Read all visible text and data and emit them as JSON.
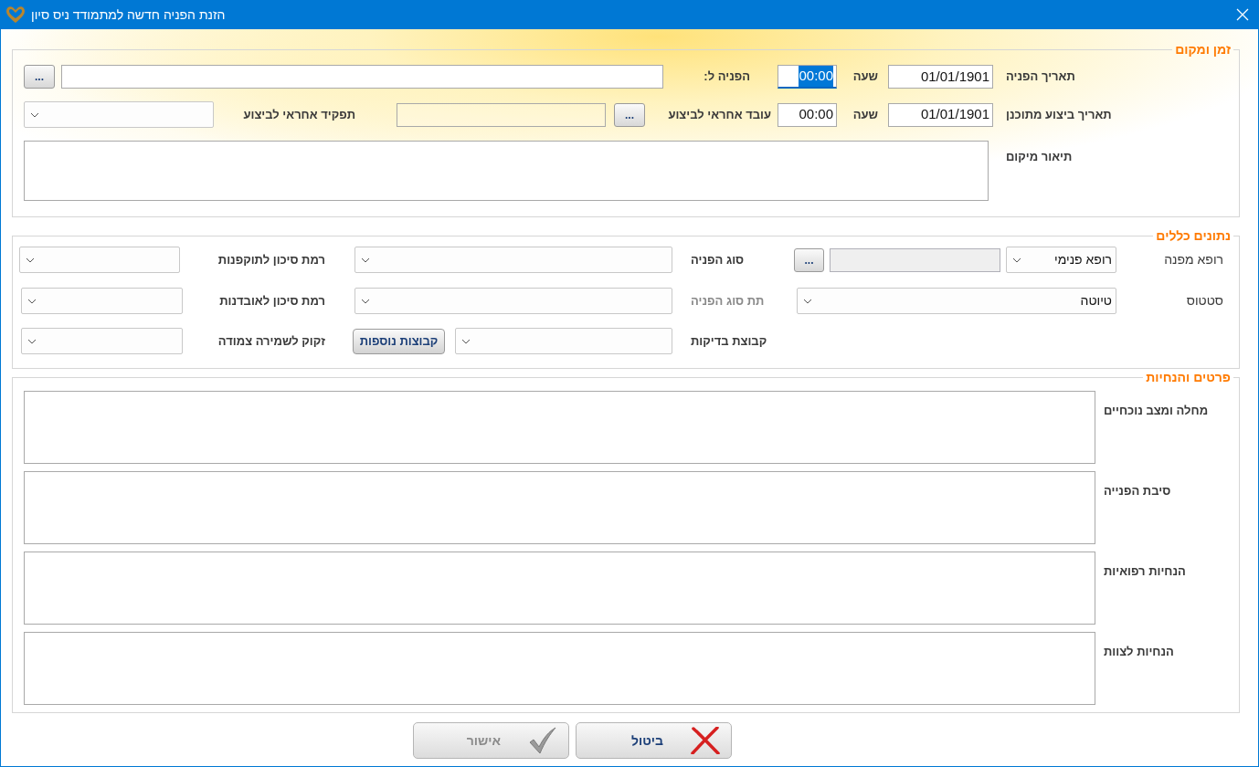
{
  "window": {
    "title": "הזנת הפניה חדשה למתמודד ניס סיון"
  },
  "time_place": {
    "title": "זמן ומקום",
    "referral_date": {
      "label": "תאריך הפניה",
      "value": "01/01/1901"
    },
    "referral_time": {
      "label": "שעה",
      "value": "00:00",
      "focused": true
    },
    "referred_to": {
      "label": "הפניה ל:",
      "button": "..."
    },
    "planned_date": {
      "label": "תאריך ביצוע מתוכנן",
      "value": "01/01/1901"
    },
    "planned_time": {
      "label": "שעה",
      "value": "00:00",
      "focused": false
    },
    "responsible_worker": {
      "label": "עובד אחראי לביצוע",
      "button": "..."
    },
    "responsible_role": {
      "label": "תפקיד אחראי לביצוע"
    },
    "location": {
      "label": "תיאור מיקום"
    }
  },
  "general": {
    "title": "נתונים כללים",
    "referring_doctor": {
      "label": "רופא מפנה",
      "value": "רופא פנימי",
      "button": "...",
      "name_box_disabled": true
    },
    "referral_type": {
      "label": "סוג הפניה"
    },
    "aggression_risk": {
      "label": "רמת סיכון לתוקפנות"
    },
    "status": {
      "label": "סטטוס",
      "value": "טיוטה"
    },
    "referral_subtype": {
      "label": "תת סוג הפניה",
      "disabled": true
    },
    "suicide_risk": {
      "label": "רמת סיכון לאובדנות"
    },
    "test_group": {
      "label": "קבוצת בדיקות"
    },
    "more_groups": {
      "label": "קבוצות נוספות"
    },
    "close_guard": {
      "label": "זקוק לשמירה צמודה"
    }
  },
  "details": {
    "title": "פרטים והנחיות",
    "fields": [
      {
        "label": "מחלה ומצב נוכחיים"
      },
      {
        "label": "סיבת הפנייה"
      },
      {
        "label": "הנחיות רפואיות"
      },
      {
        "label": "הנחיות לצוות"
      }
    ]
  },
  "buttons": [
    {
      "kind": "cancel",
      "label": "ביטול",
      "disabled": false
    },
    {
      "kind": "ok",
      "label": "אישור",
      "disabled": true
    }
  ]
}
